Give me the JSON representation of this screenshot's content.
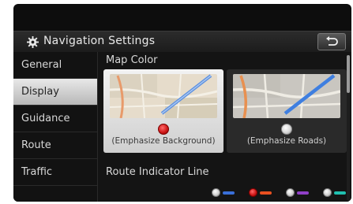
{
  "header": {
    "title": "Navigation Settings",
    "back_icon": "return-arrow-icon",
    "settings_icon": "gear-icon"
  },
  "sidebar": {
    "items": [
      {
        "label": "General",
        "active": false
      },
      {
        "label": "Display",
        "active": true
      },
      {
        "label": "Guidance",
        "active": false
      },
      {
        "label": "Route",
        "active": false
      },
      {
        "label": "Traffic",
        "active": false
      }
    ]
  },
  "main": {
    "map_color_label": "Map Color",
    "options": [
      {
        "caption": "(Emphasize Background)",
        "selected": true
      },
      {
        "caption": "(Emphasize Roads)",
        "selected": false
      }
    ],
    "route_indicator_label": "Route Indicator Line",
    "route_colors": [
      {
        "color": "#3a6fd8",
        "selected": false
      },
      {
        "color": "#e85020",
        "selected": true
      },
      {
        "color": "#9040c8",
        "selected": false
      },
      {
        "color": "#20c0b0",
        "selected": false
      }
    ]
  },
  "colors": {
    "selected_radio": "#d01a1a",
    "accent_selected_bg": "#e8e8e8"
  }
}
